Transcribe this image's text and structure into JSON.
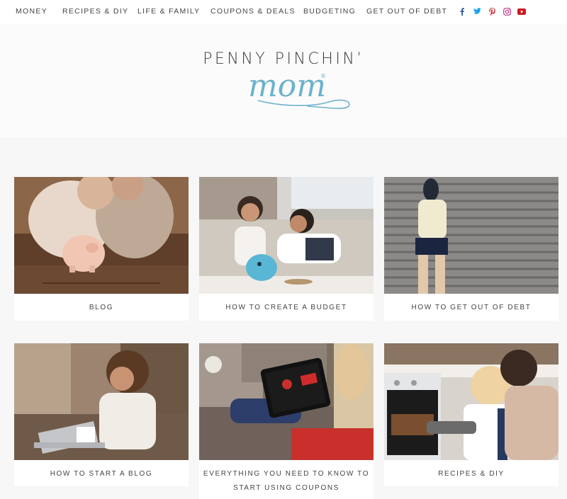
{
  "nav": {
    "items": [
      "MONEY",
      "RECIPES & DIY",
      "LIFE & FAMILY",
      "COUPONS & DEALS",
      "BUDGETING",
      "GET OUT OF DEBT"
    ]
  },
  "social": {
    "icons": [
      "facebook-icon",
      "twitter-icon",
      "pinterest-icon",
      "instagram-icon",
      "youtube-icon"
    ],
    "colors": [
      "#3b5998",
      "#1da1f2",
      "#c8232c",
      "#c13584",
      "#cc181e"
    ]
  },
  "logo": {
    "top": "PENNY PINCHIN’",
    "script": "mom",
    "mark": "®",
    "accent": "#6cb2cc"
  },
  "cards": [
    {
      "label": "BLOG"
    },
    {
      "label": "HOW TO CREATE A BUDGET"
    },
    {
      "label": "HOW TO GET OUT OF DEBT"
    },
    {
      "label": "HOW TO START A BLOG"
    },
    {
      "label": "EVERYTHING YOU NEED TO KNOW TO START USING COUPONS"
    },
    {
      "label": "RECIPES & DIY"
    }
  ]
}
